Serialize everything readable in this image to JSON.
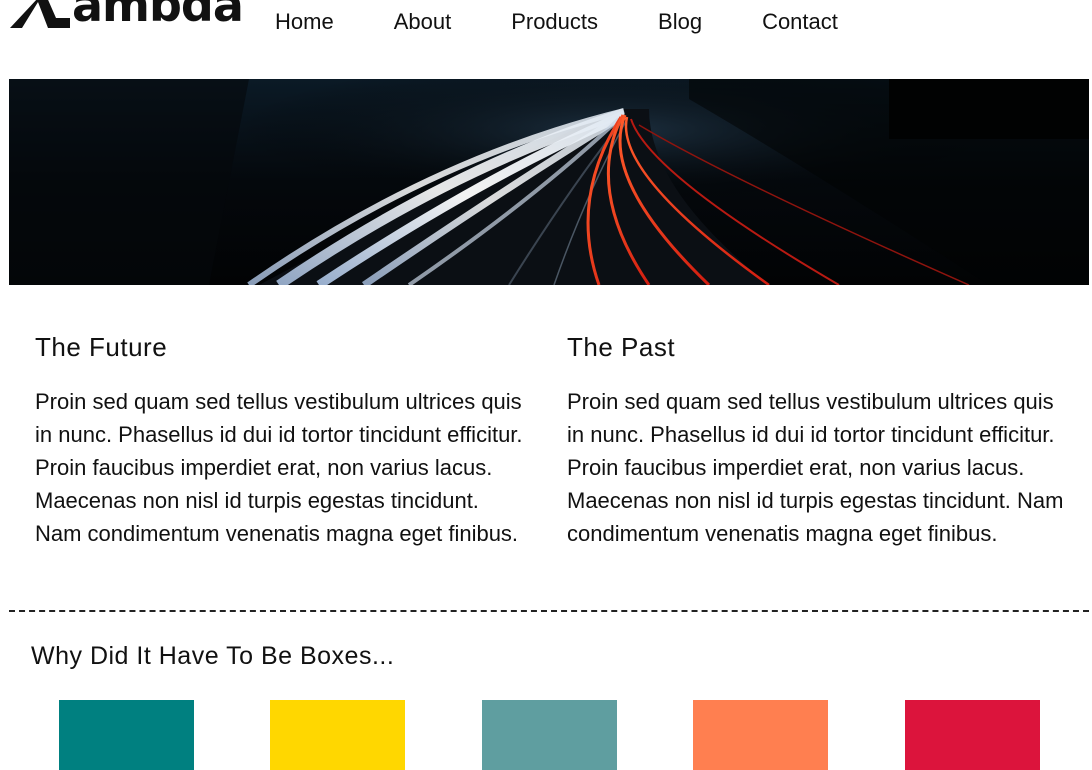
{
  "header": {
    "logo_text": "ambda",
    "nav": [
      "Home",
      "About",
      "Products",
      "Blog",
      "Contact"
    ]
  },
  "hero": {
    "icon": "highway-light-trails-image"
  },
  "columns": [
    {
      "title": "The Future",
      "body": "Proin sed quam sed tellus vestibulum ultrices quis in nunc. Phasellus id dui id tortor tincidunt efficitur. Proin faucibus imperdiet erat, non varius lacus. Maecenas non nisl id turpis egestas tincidunt. Nam condimentum venenatis magna eget finibus."
    },
    {
      "title": "The Past",
      "body": "Proin sed quam sed tellus vestibulum ultrices quis in nunc. Phasellus id dui id tortor tincidunt efficitur. Proin faucibus imperdiet erat, non varius lacus. Maecenas non nisl id turpis egestas tincidunt. Nam condimentum venenatis magna eget finibus."
    }
  ],
  "boxes_section": {
    "title": "Why Did It Have To Be Boxes...",
    "colors": [
      "#008080",
      "#FFD700",
      "#5F9EA0",
      "#FF7F50",
      "#DC143C"
    ]
  }
}
